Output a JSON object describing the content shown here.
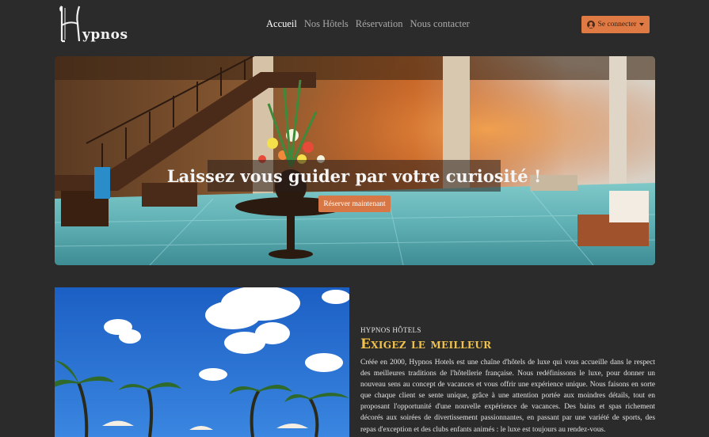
{
  "brand": {
    "logo_letter": "H",
    "name": "ypnos"
  },
  "nav": {
    "items": [
      {
        "label": "Accueil",
        "active": true
      },
      {
        "label": "Nos Hôtels",
        "active": false
      },
      {
        "label": "Réservation",
        "active": false
      },
      {
        "label": "Nous contacter",
        "active": false
      }
    ]
  },
  "account": {
    "login_label": "Se connecter",
    "icon": "user-circle-icon"
  },
  "hero": {
    "title": "Laissez vous guider par votre curiosité !",
    "cta_label": "Réserver maintenant"
  },
  "about": {
    "kicker": "HYPNOS HÔTELS",
    "heading": "Exigez le meilleur",
    "text": "Créée en 2000, Hypnos Hotels est une chaîne d'hôtels de luxe qui vous accueille dans le respect des meilleures traditions de l'hôtellerie française. Nous redéfinissons le luxe, pour donner un nouveau sens au concept de vacances et vous offrir une expérience unique. Nous faisons en sorte que chaque client se sente unique, grâce à une attention portée aux moindres détails, tout en proposant l'opportunité d'une nouvelle expérience de vacances. Des bains et spas richement décorés aux soirées de divertissement passionnantes, en passant par une variété de sports, des repas d'exception et des clubs enfants animés : le luxe est toujours au rendez-vous."
  },
  "colors": {
    "background": "#2b2b2b",
    "accent": "#e07a45",
    "heading_gold": "#f0c24a",
    "nav_active": "#ffffff",
    "nav_inactive": "#a9a9a9"
  }
}
